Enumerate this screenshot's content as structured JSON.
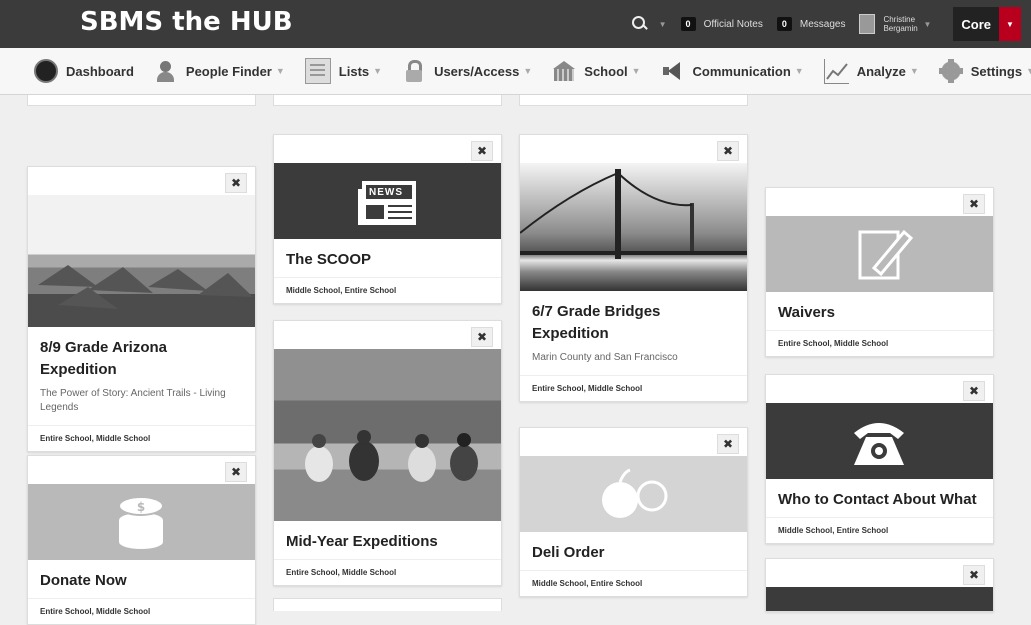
{
  "header": {
    "brand": "SBMS the HUB",
    "notes_count": "0",
    "notes_label": "Official Notes",
    "messages_count": "0",
    "messages_label": "Messages",
    "user_name": "Christine Bergamin",
    "core_label": "Core"
  },
  "nav": {
    "items": [
      {
        "label": "Dashboard",
        "icon": "dashboard-icon"
      },
      {
        "label": "People Finder",
        "icon": "people-icon"
      },
      {
        "label": "Lists",
        "icon": "list-icon"
      },
      {
        "label": "Users/Access",
        "icon": "lock-icon"
      },
      {
        "label": "School",
        "icon": "school-building-icon"
      },
      {
        "label": "Communication",
        "icon": "megaphone-icon"
      },
      {
        "label": "Analyze",
        "icon": "chart-line-icon"
      },
      {
        "label": "Settings",
        "icon": "gear-icon"
      }
    ]
  },
  "cards": {
    "arizona": {
      "title": "8/9 Grade Arizona Expedition",
      "subtitle": "The Power of Story: Ancient Trails - Living Legends",
      "tags": "Entire School, Middle School"
    },
    "donate": {
      "title": "Donate Now",
      "tags": "Entire School, Middle School"
    },
    "scoop": {
      "title": "The SCOOP",
      "tags": "Middle School, Entire School",
      "icon_text": "NEWS"
    },
    "midyear": {
      "title": "Mid-Year Expeditions",
      "tags": "Entire School, Middle School"
    },
    "bridges": {
      "title": "6/7 Grade Bridges Expedition",
      "subtitle": "Marin County and San Francisco",
      "tags": "Entire School, Middle School"
    },
    "deli": {
      "title": "Deli Order",
      "tags": "Middle School, Entire School"
    },
    "waivers": {
      "title": "Waivers",
      "tags": "Entire School, Middle School"
    },
    "contact": {
      "title": "Who to Contact About What",
      "tags": "Middle School, Entire School"
    }
  },
  "close_glyph": "✖"
}
